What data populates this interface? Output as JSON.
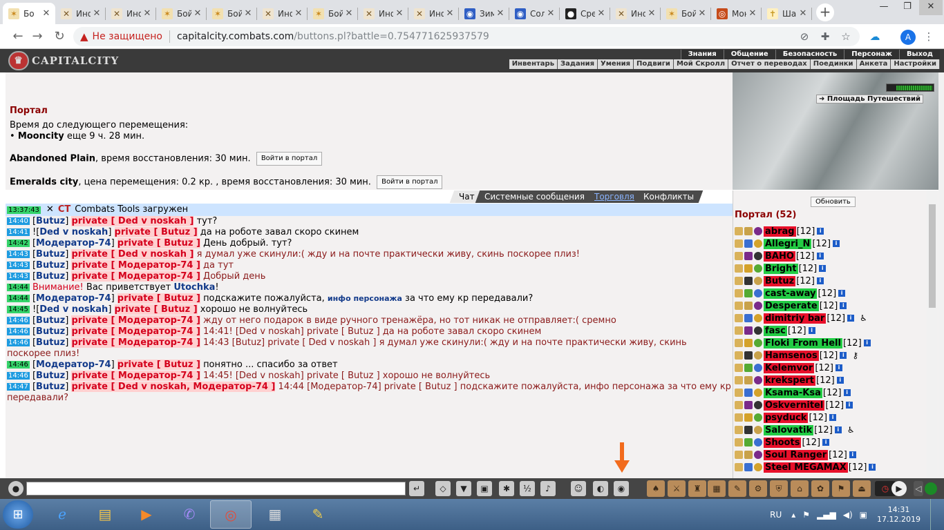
{
  "browser": {
    "tabs": [
      {
        "label": "Бо",
        "icon": "battle-icon",
        "active": true
      },
      {
        "label": "Инфо",
        "icon": "crossed-swords-icon"
      },
      {
        "label": "Инфо",
        "icon": "crossed-swords-icon"
      },
      {
        "label": "Бойцо",
        "icon": "battle-icon"
      },
      {
        "label": "Бойцо",
        "icon": "battle-icon"
      },
      {
        "label": "Инфо",
        "icon": "crossed-swords-icon"
      },
      {
        "label": "Бойцо",
        "icon": "battle-icon"
      },
      {
        "label": "Инфо",
        "icon": "crossed-swords-icon"
      },
      {
        "label": "Инфо",
        "icon": "crossed-swords-icon"
      },
      {
        "label": "Зимн",
        "icon": "globe-icon"
      },
      {
        "label": "Солне",
        "icon": "globe-icon"
      },
      {
        "label": "Средн",
        "icon": "steam-icon"
      },
      {
        "label": "Инфо",
        "icon": "crossed-swords-icon"
      },
      {
        "label": "Бойцо",
        "icon": "battle-icon"
      },
      {
        "label": "Мони",
        "icon": "target-icon"
      },
      {
        "label": "Шарм",
        "icon": "cross-icon"
      }
    ],
    "security_label": "Не защищено",
    "url_host": "capitalcity.combats.com",
    "url_path": "/buttons.pl?battle=0.754771625937579",
    "profile_initial": "A"
  },
  "game": {
    "logo_text": "CAPITALCITY",
    "top_menu": [
      "Знания",
      "Общение",
      "Безопасность",
      "Персонаж",
      "Выход"
    ],
    "sub_menu": [
      "Инвентарь",
      "Задания",
      "Умения",
      "Подвиги",
      "Мой Скролл",
      "Отчет о переводах",
      "Поединки",
      "Анкета",
      "Настройки"
    ]
  },
  "portal": {
    "title": "Портал",
    "next_move_label": "Время до следующего перемещения:",
    "bullet": "•",
    "mooncity_name": "Mooncity",
    "mooncity_time": "еще 9 ч. 28 мин.",
    "plain_name": "Abandoned Plain",
    "plain_text": ", время восстановления: 30 мин.",
    "emeralds_name": "Emeralds city",
    "emeralds_text": ", цена перемещения: 0.2 кр. , время восстановления: 30 мин.",
    "enter_button": "Войти в портал",
    "location_button": "Площадь Путешествий"
  },
  "chat_tabs": [
    "Чат",
    "Системные сообщения",
    "Торговля",
    "Конфликты"
  ],
  "chat": {
    "first": {
      "time": "13:37:43",
      "close": "✕",
      "tag": "CT",
      "text": "Combats Tools загружен"
    },
    "messages": [
      {
        "time": "14:40",
        "pre": "",
        "from": "Butuz",
        "to": "private [ Ded v noskah ]",
        "text": "тут?",
        "red": false
      },
      {
        "time": "14:41",
        "pre": "!",
        "from": "Ded v noskah",
        "to": "private [ Butuz ]",
        "text": "да на роботе завал скоро скинем",
        "red": false
      },
      {
        "time": "14:42",
        "pre": "",
        "from": "Модератор-74",
        "to": "private [ Butuz ]",
        "text": "День добрый. тут?",
        "red": false,
        "green": true
      },
      {
        "time": "14:43",
        "pre": "",
        "from": "Butuz",
        "to": "private [ Ded v noskah ]",
        "text": "я думал уже скинули:( жду и на почте практически живу, скинь поскорее плиз!",
        "red": true
      },
      {
        "time": "14:43",
        "pre": "",
        "from": "Butuz",
        "to": "private [ Модератор-74 ]",
        "text": "да тут",
        "red": true
      },
      {
        "time": "14:43",
        "pre": "",
        "from": "Butuz",
        "to": "private [ Модератор-74 ]",
        "text": "Добрый день",
        "red": true
      },
      {
        "time": "14:44",
        "sys": true,
        "warn": "Внимание!",
        "text": "Вас приветствует",
        "name": "Utochka",
        "end": "!"
      },
      {
        "time": "14:44",
        "pre": "",
        "from": "Модератор-74",
        "to": "private [ Butuz ]",
        "text": "подскажите пожалуйста,",
        "info": "инфо персонажа",
        "text2": "за что ему кр передавали?",
        "red": false,
        "green": true
      },
      {
        "time": "14:45",
        "pre": "!",
        "from": "Ded v noskah",
        "to": "private [ Butuz ]",
        "text": "хорошо не волнуйтесь",
        "red": false,
        "green": true
      },
      {
        "time": "14:46",
        "pre": "",
        "from": "Butuz",
        "to": "private [ Модератор-74 ]",
        "text": "жду от него подарок в виде ручного тренажёра, но тот никак не отправляет:( сремно",
        "red": true
      },
      {
        "time": "14:46",
        "pre": "",
        "from": "Butuz",
        "to": "private [ Модератор-74 ]",
        "text": "14:41! [Ded v noskah] private [ Butuz ] да на роботе завал скоро скинем",
        "red": true
      },
      {
        "time": "14:46",
        "pre": "",
        "from": "Butuz",
        "to": "private [ Модератор-74 ]",
        "text": "14:43 [Butuz] private [ Ded v noskah ] я думал уже скинули:( жду и на почте практически живу, скинь поскорее плиз!",
        "red": true
      },
      {
        "time": "14:46",
        "pre": "",
        "from": "Модератор-74",
        "to": "private [ Butuz ]",
        "text": "понятно ... спасибо за ответ",
        "red": false,
        "green": true
      },
      {
        "time": "14:46",
        "pre": "",
        "from": "Butuz",
        "to": "private [ Модератор-74 ]",
        "text": "14:45! [Ded v noskah] private [ Butuz ] хорошо не волнуйтесь",
        "red": true
      },
      {
        "time": "14:47",
        "pre": "",
        "from": "Butuz",
        "to": "private [ Ded v noskah, Модератор-74 ]",
        "text": "14:44 [Модератор-74] private [ Butuz ] подскажите пожалуйста, инфо персонажа за что ему кр передавали?",
        "red": true
      }
    ]
  },
  "userlist": {
    "refresh": "Обновить",
    "header": "Портал (52)",
    "users": [
      {
        "name": "abrag",
        "level": "[12]",
        "bg": "#e8102a"
      },
      {
        "name": "Allegri_N",
        "level": "[12]",
        "bg": "#22cc44"
      },
      {
        "name": "BAHO",
        "level": "[12]",
        "bg": "#e8102a"
      },
      {
        "name": "Bright",
        "level": "[12]",
        "bg": "#22cc44"
      },
      {
        "name": "Butuz",
        "level": "[12]",
        "bg": "#e8102a"
      },
      {
        "name": "cast-away",
        "level": "[12]",
        "bg": "#22cc44"
      },
      {
        "name": "Desperate",
        "level": "[12]",
        "bg": "#22cc44"
      },
      {
        "name": "dimitriy bar",
        "level": "[12]",
        "bg": "#e8102a",
        "extra": "♿"
      },
      {
        "name": "fasc",
        "level": "[12]",
        "bg": "#22cc44"
      },
      {
        "name": "Floki From Hell",
        "level": "[12]",
        "bg": "#22cc44"
      },
      {
        "name": "Hamsenos",
        "level": "[12]",
        "bg": "#e8102a",
        "extra": "⚷"
      },
      {
        "name": "Kelemvor",
        "level": "[12]",
        "bg": "#e8102a"
      },
      {
        "name": "krekspert",
        "level": "[12]",
        "bg": "#e8102a"
      },
      {
        "name": "Ksama-Ksa",
        "level": "[12]",
        "bg": "#22cc44"
      },
      {
        "name": "Oskvernitel",
        "level": "[12]",
        "bg": "#e8102a"
      },
      {
        "name": "psyduck",
        "level": "[12]",
        "bg": "#e8102a"
      },
      {
        "name": "Salovatik",
        "level": "[12]",
        "bg": "#22cc44",
        "extra": "♿"
      },
      {
        "name": "Shoots",
        "level": "[12]",
        "bg": "#e8102a"
      },
      {
        "name": "Soul Ranger",
        "level": "[12]",
        "bg": "#e8102a"
      },
      {
        "name": "Steel MEGAMAX",
        "level": "[12]",
        "bg": "#e8102a"
      }
    ]
  },
  "taskbar": {
    "lang": "RU",
    "time": "14:31",
    "date": "17.12.2019"
  }
}
